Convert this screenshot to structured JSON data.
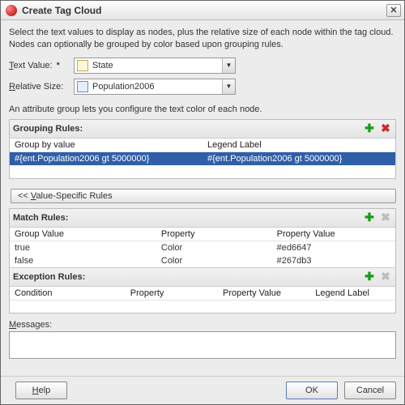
{
  "window": {
    "title": "Create Tag Cloud"
  },
  "intro": "Select the text values to display as nodes, plus the relative size of each node within the tag cloud. Nodes can optionally be grouped by color based upon grouping rules.",
  "form": {
    "text_value_label": "Text Value:",
    "text_value_required": "*",
    "text_value": "State",
    "relative_size_label": "Relative Size:",
    "relative_size": "Population2006"
  },
  "attr_note": "An attribute group lets you configure the text color of each node.",
  "grouping": {
    "title": "Grouping Rules:",
    "columns": {
      "group_by": "Group by value",
      "legend": "Legend Label"
    },
    "rows": [
      {
        "group_by": "#{ent.Population2006 gt 5000000}",
        "legend": "#{ent.Population2006 gt 5000000}"
      }
    ]
  },
  "value_specific_btn": "<< Value-Specific Rules",
  "match": {
    "title": "Match Rules:",
    "columns": {
      "gv": "Group Value",
      "prop": "Property",
      "pv": "Property Value"
    },
    "rows": [
      {
        "gv": "true",
        "prop": "Color",
        "pv": "#ed6647"
      },
      {
        "gv": "false",
        "prop": "Color",
        "pv": "#267db3"
      }
    ]
  },
  "exception": {
    "title": "Exception Rules:",
    "columns": {
      "cond": "Condition",
      "prop": "Property",
      "pv": "Property Value",
      "legend": "Legend Label"
    }
  },
  "messages_label": "Messages:",
  "buttons": {
    "help": "Help",
    "ok": "OK",
    "cancel": "Cancel"
  },
  "glyphs": {
    "close": "✕",
    "plus": "✚",
    "del": "✖",
    "arrow": "▼"
  }
}
